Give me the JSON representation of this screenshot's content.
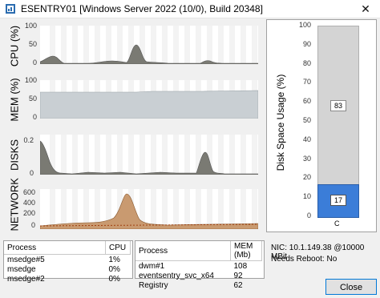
{
  "window": {
    "title": "ESENTRY01 [Windows Server 2022 (10/0), Build 20348]",
    "close_glyph": "✕"
  },
  "charts": {
    "cpu": {
      "label": "CPU (%)",
      "ticks": [
        "100",
        "50",
        "0"
      ]
    },
    "mem": {
      "label": "MEM (%)",
      "ticks": [
        "100",
        "50",
        "0"
      ]
    },
    "disks": {
      "label": "DISKS",
      "ticks": [
        "0.2",
        "0"
      ]
    },
    "network": {
      "label": "NETWORK",
      "ticks": [
        "600",
        "400",
        "200",
        "0"
      ]
    }
  },
  "disk_usage": {
    "label": "Disk Space Usage (%)",
    "ticks": [
      "100",
      "90",
      "80",
      "70",
      "60",
      "50",
      "40",
      "30",
      "20",
      "10",
      "0"
    ],
    "drive_label": "C",
    "free_value": "83",
    "used_value": "17",
    "used_percent": 17
  },
  "cpu_table": {
    "headers": [
      "Process",
      "CPU"
    ],
    "rows": [
      [
        "msedge#5",
        "1%"
      ],
      [
        "msedge",
        "0%"
      ],
      [
        "msedge#2",
        "0%"
      ]
    ]
  },
  "mem_table": {
    "headers": [
      "Process",
      "MEM (Mb)"
    ],
    "rows": [
      [
        "dwm#1",
        "108"
      ],
      [
        "eventsentry_svc_x64",
        "92"
      ],
      [
        "Registry",
        "62"
      ]
    ]
  },
  "nic": "NIC: 10.1.149.38 @10000 MBit",
  "reboot": "Needs Reboot: No",
  "close_button": "Close",
  "colors": {
    "cpu_fill": "#7a7a73",
    "disk_fill": "#7a7a73",
    "mem_fill": "#c9cfd3",
    "net_fill": "#c99a70",
    "disk_free": "#d4d4d4",
    "disk_used": "#3b7dd8"
  }
}
